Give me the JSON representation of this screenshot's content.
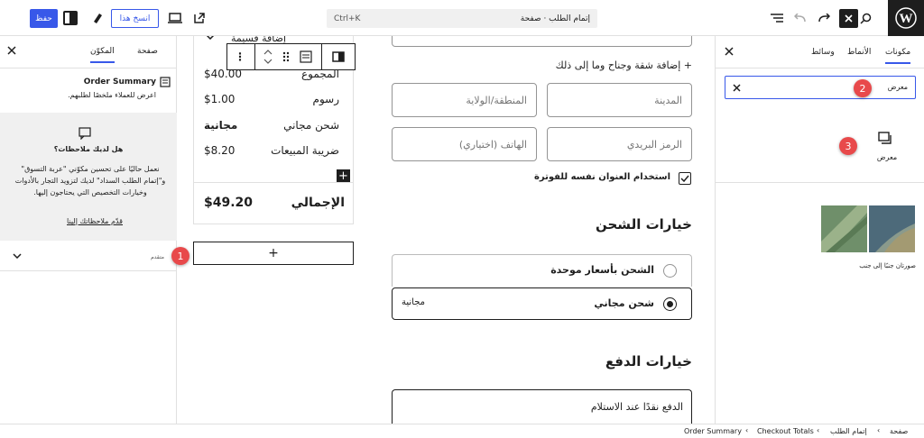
{
  "topbar": {
    "command_label": "إتمام الطلب · صفحة",
    "command_shortcut": "Ctrl+K",
    "save_label": "حفظ",
    "save_as_label": "انسخ هذا"
  },
  "left_panel": {
    "tab_block": "المكوّن",
    "tab_page": "صفحة",
    "block_title": "Order Summary",
    "block_desc": "اعرض للعملاء ملخصًا لطلبهم.",
    "feedback_title": "هل لديك ملاحظات؟",
    "feedback_body": "نعمل حاليًا على تحسين مكوّني \"عربة التسوق\" و\"إتمام الطلب السداد\" لديك لتزويد التجار بالأدوات وخيارات التخصيص التي يحتاجون إليها.",
    "feedback_link": "قدّم ملاحظاتك إلينا",
    "advanced_label": "متقدم"
  },
  "canvas": {
    "add_coupon": "إضافة قسيمة",
    "totals": [
      {
        "label": "المجموع",
        "value": "$40.00"
      },
      {
        "label": "رسوم",
        "value": "$1.00"
      },
      {
        "label": "شحن مجاني",
        "value": "مجانية"
      },
      {
        "label": "ضريبة المبيعات",
        "value": "$8.20"
      }
    ],
    "total_label": "الإجمالي",
    "total_value": "$49.20",
    "add_apartment": "+ إضافة شقة وجناح وما إلى ذلك",
    "city_placeholder": "المدينة",
    "state_placeholder": "المنطقة/الولاية",
    "postcode_placeholder": "الرمز البريدي",
    "phone_placeholder": "الهاتف (اختياري)",
    "same_billing_label": "استخدام العنوان نفسه للفوترة",
    "shipping_heading": "خيارات الشحن",
    "shipping_options": [
      {
        "label": "الشحن بأسعار موحدة",
        "price": "",
        "selected": false
      },
      {
        "label": "شحن مجاني",
        "price": "مجانية",
        "selected": true
      }
    ],
    "payment_heading": "خيارات الدفع",
    "payment_option": "الدفع نقدًا عند الاستلام"
  },
  "right_panel": {
    "tab_blocks": "مكونات",
    "tab_patterns": "الأنماط",
    "tab_media": "وسائط",
    "search_value": "معرض",
    "block_result_label": "معرض",
    "pattern_label": "صورتان جنبًا إلى جنب"
  },
  "breadcrumb": [
    "صفحة",
    "إتمام الطلب",
    "Checkout Totals",
    "Order Summary"
  ],
  "badges": [
    "1",
    "2",
    "3"
  ],
  "colors": {
    "accent": "#3858e9",
    "badge": "#e8494b",
    "dark": "#1e1e1e"
  }
}
